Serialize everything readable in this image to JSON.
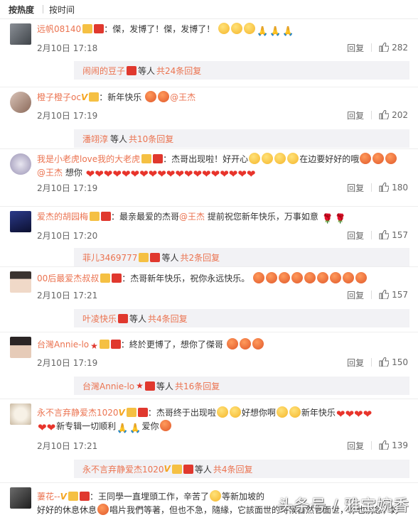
{
  "tabs": {
    "hot": "按热度",
    "time": "按时间"
  },
  "comments": [
    {
      "user": "远帆08140",
      "text": "：傑，发博了！傑，发博了！",
      "time": "2月10日 17:18",
      "reply": "回复",
      "likes": "282",
      "sub": {
        "user": "闹闹的豆子",
        "suffix": "等人",
        "more": "共24条回复"
      }
    },
    {
      "user": "橙子橙子oc",
      "text": "：新年快乐",
      "mention": "@王杰",
      "time": "2月10日 17:19",
      "reply": "回复",
      "likes": "202",
      "sub": {
        "user": "潘翊淳",
        "suffix": "等人",
        "more": "共10条回复"
      }
    },
    {
      "user": "我是小老虎love我的大老虎",
      "text": "：杰哥出现啦！好开心",
      "text2": "在边要好好的哦",
      "mention": "@王杰",
      "text3": " 想你",
      "time": "2月10日 17:19",
      "reply": "回复",
      "likes": "180"
    },
    {
      "user": "爱杰的胡园梅",
      "text": "：最亲最爱的杰哥",
      "mention": "@王杰",
      "text2": " 提前祝您新年快乐，万事如意",
      "time": "2月10日 17:20",
      "reply": "回复",
      "likes": "157",
      "sub": {
        "user": "菲儿3469777",
        "suffix": "等人",
        "more": "共2条回复"
      }
    },
    {
      "user": "00后最爱杰叔叔",
      "text": "：杰哥新年快乐，祝你永远快乐。",
      "time": "2月10日 17:21",
      "reply": "回复",
      "likes": "157",
      "sub": {
        "user": "叶凌快乐",
        "suffix": "等人",
        "more": "共4条回复"
      }
    },
    {
      "user": "台灣Annie-lo",
      "text": "：終於更博了，想你了傑哥",
      "time": "2月10日 17:19",
      "reply": "回复",
      "likes": "150",
      "sub": {
        "user": "台灣Annie-lo",
        "suffix": "等人",
        "more": "共16条回复"
      }
    },
    {
      "user": "永不言弃静爱杰1020",
      "text": "：杰哥终于出现啦",
      "text2": "好想你啊",
      "text3": "新年快乐",
      "text4": "新专辑一切顺利",
      "text5": "爱你",
      "time": "2月10日 17:21",
      "reply": "回复",
      "likes": "139",
      "sub": {
        "user": "永不言弃静爱杰1020",
        "suffix": "等人",
        "more": "共4条回复"
      }
    },
    {
      "user": "萋花--",
      "text": "：王同學一直埋頭工作，辛苦了",
      "text2": "等新加坡的",
      "text3": "好好的休息休息",
      "text4": "唱片我們等著，但也不急，隨緣，它該面世的時候自然會面世，你也別急，好"
    }
  ],
  "watermark": "头条号 / 雅宝婉香",
  "colors": {
    "username": "#eb7350",
    "subBg": "#f2f2f5"
  }
}
